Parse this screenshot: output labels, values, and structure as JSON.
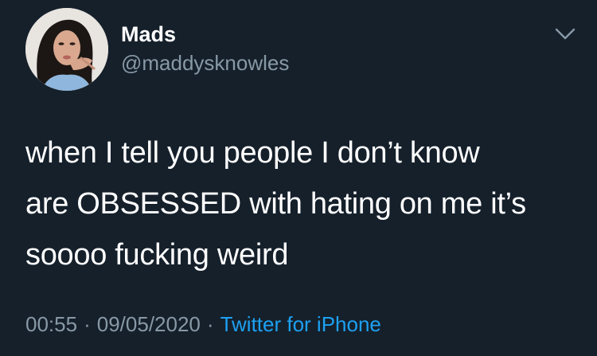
{
  "user": {
    "display_name": "Mads",
    "handle": "@maddysknowles"
  },
  "tweet": {
    "text": "when I tell you people I don’t know\nare OBSESSED with hating on me it’s\nsoooo fucking weird",
    "time": "00:55",
    "date": "09/05/2020",
    "source": "Twitter for iPhone",
    "separator": "·"
  },
  "icons": {
    "menu": "chevron-down-icon",
    "avatar": "profile-photo"
  },
  "colors": {
    "background": "#15202b",
    "primary_text": "#ffffff",
    "secondary_text": "#8899a6",
    "link": "#1da1f2"
  }
}
